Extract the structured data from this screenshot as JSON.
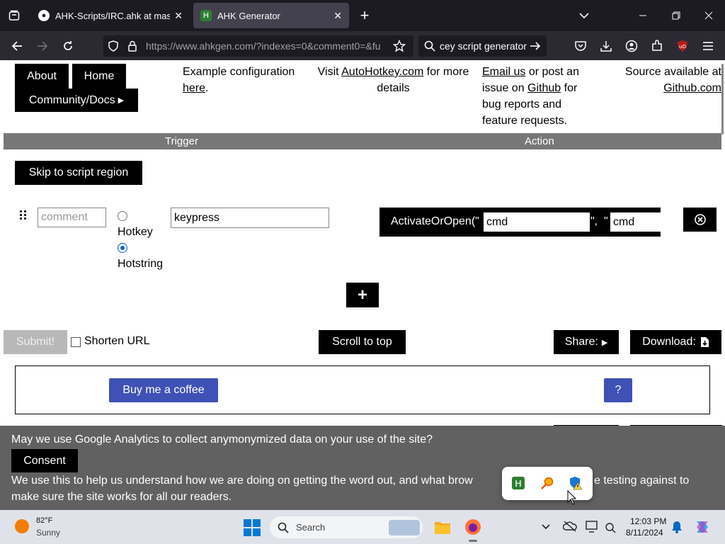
{
  "browser": {
    "tabs": [
      {
        "title": "AHK-Scripts/IRC.ahk at master",
        "icon": "github-icon",
        "active": false
      },
      {
        "title": "AHK Generator",
        "icon": "ahk-h-icon",
        "active": true
      }
    ],
    "url_main": "https://www.ahkgen.com",
    "url_rest": "/?indexes=0&comment0=&fu",
    "search_text": "cey script generator"
  },
  "nav": {
    "about": "About",
    "home": "Home",
    "community": "Community/Docs"
  },
  "info": {
    "example_text": "Example configuration",
    "example_link": "here",
    "example_end": ".",
    "visit_text": "Visit",
    "visit_link": "AutoHotkey.com",
    "visit_end": "for more",
    "visit_end2": "details",
    "email_link": "Email us",
    "email_text": "or post an",
    "email_text2": "issue on",
    "github_link": "Github",
    "email_text3": "for",
    "email_text4": "bug reports and",
    "email_text5": "feature requests.",
    "source_text": "Source available at",
    "source_link": "Github.com"
  },
  "headers": {
    "trigger": "Trigger",
    "action": "Action"
  },
  "skip_button": "Skip to script region",
  "row": {
    "comment_placeholder": "comment",
    "hotkey_label": "Hotkey",
    "hotstring_label": "Hotstring",
    "selected_type": "Hotstring",
    "keypress_value": "keypress",
    "action_func": "ActivateOrOpen(\"",
    "action_arg1": "cmd",
    "action_sep": "\",  \"",
    "action_arg2": "cmd"
  },
  "add_button": "+",
  "controls": {
    "submit": "Submit!",
    "shorten": "Shorten URL",
    "scroll_top": "Scroll to top",
    "share": "Share:",
    "download": "Download:"
  },
  "coffee": {
    "button": "Buy me a coffee",
    "help": "?"
  },
  "consent": {
    "question": "May we use Google Analytics to collect anymonymized data on your use of the site?",
    "button": "Consent",
    "line2_a": "We use this to help us understand how we are doing on getting the word out, and what brow",
    "line2_b": "e testing against to",
    "line3": "make sure the site works for all our readers."
  },
  "taskbar": {
    "weather_temp": "82°F",
    "weather_desc": "Sunny",
    "search_label": "Search",
    "time": "12:03 PM",
    "date": "8/11/2024"
  },
  "colors": {
    "accent_blue": "#3f51b5",
    "header_gray": "#777777",
    "consent_bg": "#616161"
  }
}
